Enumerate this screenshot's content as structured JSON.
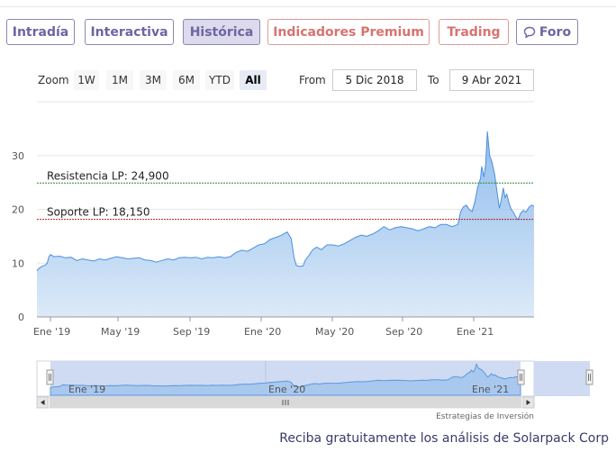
{
  "tabs": [
    {
      "label": "Intradía",
      "style": "purple",
      "active": false
    },
    {
      "label": "Interactiva",
      "style": "purple",
      "active": false
    },
    {
      "label": "Histórica",
      "style": "purple",
      "active": true
    },
    {
      "label": "Indicadores Premium",
      "style": "red",
      "active": false
    },
    {
      "label": "Trading",
      "style": "red",
      "active": false
    },
    {
      "label": "Foro",
      "style": "purple",
      "active": false,
      "icon": "chat-bubble-icon"
    }
  ],
  "range_selector": {
    "zoom_label": "Zoom",
    "buttons": [
      "1W",
      "1M",
      "3M",
      "6M",
      "YTD",
      "All"
    ],
    "selected": "All",
    "from_label": "From",
    "from_value": "5 Dic 2018",
    "to_label": "To",
    "to_value": "9 Abr 2021"
  },
  "chart_data": {
    "type": "area",
    "y_ticks": [
      "0",
      "10",
      "20",
      "30"
    ],
    "ylim": [
      0,
      36
    ],
    "x_ticks": [
      "Ene '19",
      "May '19",
      "Sep '19",
      "Ene '20",
      "May '20",
      "Sep '20",
      "Ene '21"
    ],
    "navigator_ticks": [
      "Ene '19",
      "Ene '20",
      "Ene '21"
    ],
    "lines": [
      {
        "label": "Resistencia LP: 24,900",
        "value": 24.9,
        "color": "#2e8b2e"
      },
      {
        "label": "Soporte LP: 18,150",
        "value": 18.15,
        "color": "#b22222"
      }
    ],
    "series": [
      {
        "values": [
          [
            0,
            8.6
          ],
          [
            3,
            9
          ],
          [
            6,
            9.2
          ],
          [
            10,
            9.5
          ],
          [
            14,
            9.6
          ],
          [
            18,
            10
          ],
          [
            21,
            11.2
          ],
          [
            24,
            11.6
          ],
          [
            30,
            11.2
          ],
          [
            40,
            11.3
          ],
          [
            50,
            11
          ],
          [
            60,
            11.1
          ],
          [
            70,
            10.5
          ],
          [
            80,
            10.8
          ],
          [
            90,
            10.6
          ],
          [
            100,
            10.4
          ],
          [
            110,
            10.8
          ],
          [
            120,
            10.6
          ],
          [
            130,
            10.9
          ],
          [
            140,
            11.2
          ],
          [
            150,
            11
          ],
          [
            160,
            10.8
          ],
          [
            170,
            10.9
          ],
          [
            180,
            11
          ],
          [
            190,
            10.6
          ],
          [
            200,
            10.5
          ],
          [
            210,
            10.2
          ],
          [
            220,
            10.5
          ],
          [
            230,
            10.8
          ],
          [
            240,
            10.6
          ],
          [
            250,
            11
          ],
          [
            260,
            11.1
          ],
          [
            270,
            11
          ],
          [
            280,
            11.1
          ],
          [
            290,
            10.8
          ],
          [
            300,
            11.1
          ],
          [
            310,
            11
          ],
          [
            320,
            11.2
          ],
          [
            330,
            11
          ],
          [
            340,
            11.2
          ],
          [
            350,
            12
          ],
          [
            360,
            12.4
          ],
          [
            370,
            12.2
          ],
          [
            380,
            12.8
          ],
          [
            390,
            13.4
          ],
          [
            400,
            13.6
          ],
          [
            410,
            14.4
          ],
          [
            420,
            14.8
          ],
          [
            430,
            15.2
          ],
          [
            440,
            15.8
          ],
          [
            447,
            14.6
          ],
          [
            452,
            11
          ],
          [
            456,
            9.6
          ],
          [
            462,
            9.4
          ],
          [
            468,
            9.5
          ],
          [
            472,
            10.6
          ],
          [
            478,
            11.4
          ],
          [
            485,
            12.5
          ],
          [
            492,
            13
          ],
          [
            500,
            12.5
          ],
          [
            510,
            13.4
          ],
          [
            520,
            13.4
          ],
          [
            530,
            13.2
          ],
          [
            540,
            13.6
          ],
          [
            550,
            14.2
          ],
          [
            560,
            14.8
          ],
          [
            570,
            15.2
          ],
          [
            580,
            15
          ],
          [
            590,
            15.4
          ],
          [
            600,
            16
          ],
          [
            610,
            16.8
          ],
          [
            620,
            16.2
          ],
          [
            630,
            16.6
          ],
          [
            640,
            16.8
          ],
          [
            650,
            16.6
          ],
          [
            660,
            16.4
          ],
          [
            670,
            16
          ],
          [
            680,
            16.4
          ],
          [
            690,
            16.8
          ],
          [
            700,
            16.6
          ],
          [
            710,
            17.2
          ],
          [
            720,
            17.2
          ],
          [
            730,
            16.8
          ],
          [
            740,
            17.2
          ],
          [
            745,
            19.6
          ],
          [
            750,
            20.5
          ],
          [
            755,
            20.8
          ],
          [
            760,
            20
          ],
          [
            765,
            19.6
          ],
          [
            770,
            21.4
          ],
          [
            775,
            24.2
          ],
          [
            780,
            25.8
          ],
          [
            782,
            28
          ],
          [
            786,
            26
          ],
          [
            789,
            28.4
          ],
          [
            792,
            34.5
          ],
          [
            796,
            30
          ],
          [
            800,
            28.8
          ],
          [
            805,
            26.4
          ],
          [
            810,
            22.4
          ],
          [
            813,
            20.2
          ],
          [
            816,
            21.6
          ],
          [
            820,
            24
          ],
          [
            823,
            22.2
          ],
          [
            826,
            22.8
          ],
          [
            830,
            21.2
          ],
          [
            834,
            20
          ],
          [
            838,
            19.4
          ],
          [
            842,
            18.6
          ],
          [
            846,
            18.1
          ],
          [
            850,
            19.2
          ],
          [
            855,
            19.8
          ],
          [
            860,
            19.5
          ],
          [
            865,
            20.4
          ],
          [
            870,
            20.8
          ],
          [
            874,
            20.6
          ]
        ]
      }
    ]
  },
  "credit": "Estrategias de Inversión",
  "footer_text": "Reciba gratuitamente los análisis de Solarpack Corp"
}
